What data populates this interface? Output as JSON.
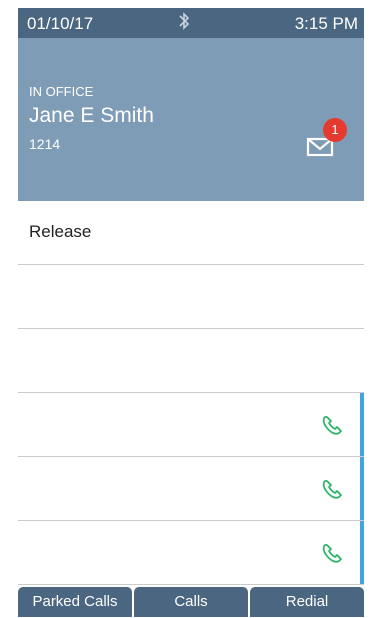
{
  "status": {
    "date": "01/10/17",
    "time": "3:15 PM",
    "bluetooth_icon": "bluetooth-icon"
  },
  "user": {
    "presence": "IN OFFICE",
    "name": "Jane E Smith",
    "extension": "1214"
  },
  "voicemail": {
    "count": "1",
    "icon": "envelope-icon",
    "badge_color": "#e53a2f"
  },
  "lines": [
    {
      "label": "Release",
      "has_phone": false
    },
    {
      "label": "",
      "has_phone": false
    },
    {
      "label": "",
      "has_phone": false
    },
    {
      "label": "",
      "has_phone": true
    },
    {
      "label": "",
      "has_phone": true
    },
    {
      "label": "",
      "has_phone": true
    }
  ],
  "softkeys": [
    "Parked Calls",
    "Calls",
    "Redial"
  ],
  "colors": {
    "header": "#7f9cb6",
    "bar": "#4a6680",
    "accent": "#3fa5e0",
    "phone": "#2db56a"
  }
}
